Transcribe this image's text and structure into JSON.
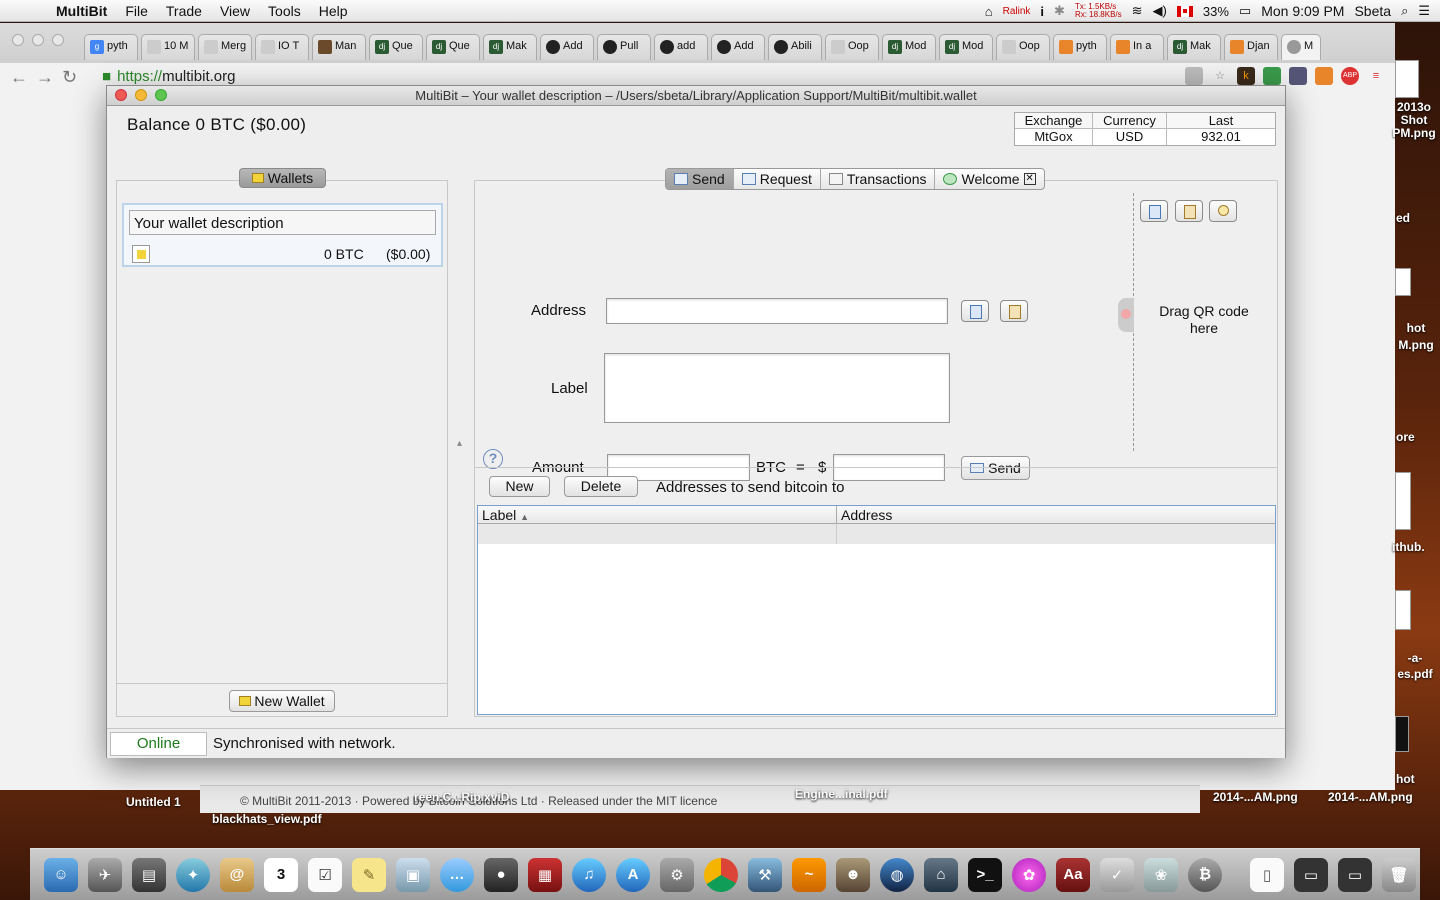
{
  "menubar": {
    "app_name": "MultiBit",
    "items": [
      "File",
      "Trade",
      "View",
      "Tools",
      "Help"
    ],
    "ralink": "Ralink",
    "net_tx": "Tx:   1.5KB/s",
    "net_rx": "Rx:  18.8KB/s",
    "battery": "33%",
    "clock": "Mon 9:09 PM",
    "user": "Sbeta"
  },
  "browser": {
    "tabs": [
      "pyth",
      "10 M",
      "Merg",
      "IO T",
      "Man",
      "Que",
      "Que",
      "Mak",
      "Add",
      "Pull",
      "add",
      "Add",
      "Abili",
      "Oop",
      "Mod",
      "Mod",
      "Oop",
      "pyth",
      "In a",
      "Mak",
      "Djan",
      "M"
    ],
    "url_scheme": "https://",
    "url_host": "multibit.org",
    "ext_k": "k",
    "ext_abp": "ABP",
    "footer_text": "© MultiBit 2011-2013 · Powered by Bitcoin Solutions Ltd · Released under the MIT licence"
  },
  "desktop": {
    "files": [
      "2013o Shot PM.png",
      "ed",
      "hot M.png",
      "ore",
      "ithub.",
      "-a- es.pdf",
      "hot",
      "2014-...AM.png",
      "2014-...AM.png",
      "Untitled 1",
      "blackhats_view.pdf",
      "reen.C...Rip.xviD",
      "Engine...inal.pdf"
    ]
  },
  "window": {
    "title": "MultiBit – Your wallet description – /Users/sbeta/Library/Application Support/MultiBit/multibit.wallet",
    "balance": "Balance 0 BTC  ($0.00)",
    "ticker": {
      "headers": [
        "Exchange",
        "Currency",
        "Last"
      ],
      "values": [
        "MtGox",
        "USD",
        "932.01"
      ]
    },
    "wallets_label": "Wallets",
    "wallet": {
      "description": "Your wallet description",
      "btc": "0 BTC",
      "fiat": "($0.00)"
    },
    "new_wallet_label": "New Wallet",
    "tabs": [
      "Send",
      "Request",
      "Transactions",
      "Welcome"
    ],
    "send": {
      "address_label": "Address",
      "label_label": "Label",
      "amount_label": "Amount",
      "btc_unit": "BTC",
      "equals": "=",
      "dollar": "$",
      "send_button": "Send",
      "qr_text": "Drag QR code here",
      "help": "?"
    },
    "address_book": {
      "new_button": "New",
      "delete_button": "Delete",
      "heading": "Addresses to send bitcoin to",
      "columns": [
        "Label",
        "Address"
      ]
    },
    "status": {
      "online": "Online",
      "message": "Synchronised with network."
    }
  }
}
